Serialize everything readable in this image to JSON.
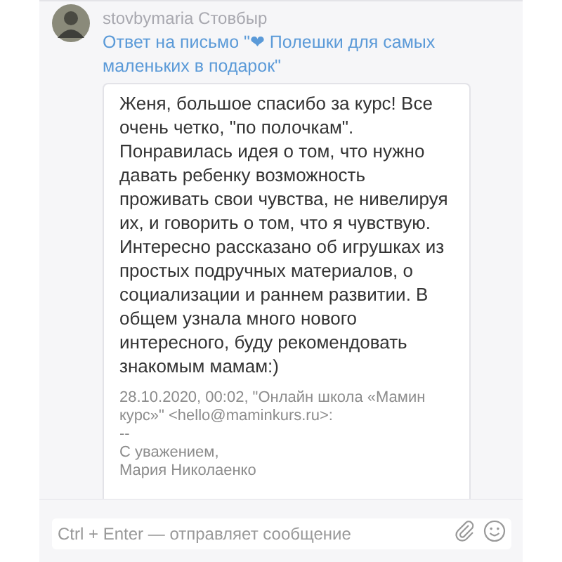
{
  "message": {
    "author": "stovbymaria Стовбыр",
    "subject": "Ответ на письмо \"❤ Полешки для самых маленьких в подарок\"",
    "body": "Женя, большое спасибо за курс! Все очень четко, \"по полочкам\". Понравилась идея о том, что нужно давать ребенку возможность проживать свои чувства, не нивелируя их, и говорить о том, что я чувствую. Интересно рассказано об игрушках из простых подручных материалов, о социализации и раннем развитии. В общем узнала много нового интересного, буду рекомендовать знакомым мамам:)",
    "quote": "28.10.2020, 00:02, \"Онлайн школа «Мамин курс»\" <hello@maminkurs.ru>:",
    "signature": [
      "--",
      "С уважением,",
      "Мария Николаенко"
    ]
  },
  "composer": {
    "placeholder": "Ctrl + Enter — отправляет сообщение"
  }
}
